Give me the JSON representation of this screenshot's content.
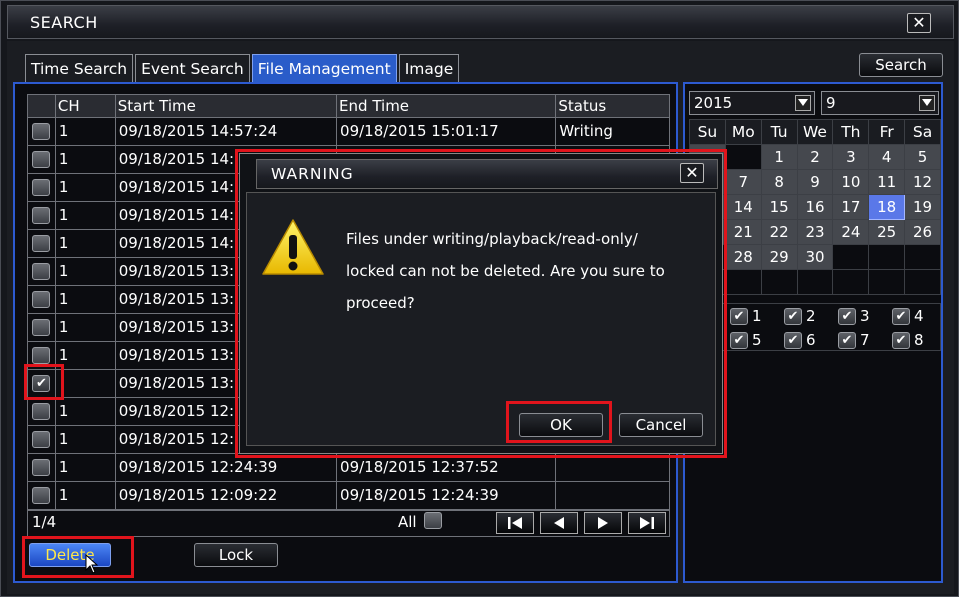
{
  "window": {
    "title": "SEARCH"
  },
  "tabs": [
    {
      "label": "Time Search",
      "active": false
    },
    {
      "label": "Event Search",
      "active": false
    },
    {
      "label": "File Management",
      "active": true
    },
    {
      "label": "Image",
      "active": false
    }
  ],
  "search_button": "Search",
  "table": {
    "headers": [
      "CH",
      "Start Time",
      "End Time",
      "Status"
    ],
    "rows": [
      {
        "ch": "1",
        "start": "09/18/2015 14:57:24",
        "end": "09/18/2015 15:01:17",
        "status": "Writing",
        "checked": false
      },
      {
        "ch": "1",
        "start": "09/18/2015 14:",
        "end": "",
        "status": "",
        "checked": false
      },
      {
        "ch": "1",
        "start": "09/18/2015 14:",
        "end": "",
        "status": "",
        "checked": false
      },
      {
        "ch": "1",
        "start": "09/18/2015 14:",
        "end": "",
        "status": "",
        "checked": false
      },
      {
        "ch": "1",
        "start": "09/18/2015 14:",
        "end": "",
        "status": "",
        "checked": false
      },
      {
        "ch": "1",
        "start": "09/18/2015 13:",
        "end": "",
        "status": "",
        "checked": false
      },
      {
        "ch": "1",
        "start": "09/18/2015 13:",
        "end": "",
        "status": "",
        "checked": false
      },
      {
        "ch": "1",
        "start": "09/18/2015 13:",
        "end": "",
        "status": "",
        "checked": false
      },
      {
        "ch": "1",
        "start": "09/18/2015 13:",
        "end": "",
        "status": "",
        "checked": false
      },
      {
        "ch": "",
        "start": "09/18/2015 13:",
        "end": "",
        "status": "",
        "checked": true
      },
      {
        "ch": "1",
        "start": "09/18/2015 12:",
        "end": "",
        "status": "",
        "checked": false
      },
      {
        "ch": "1",
        "start": "09/18/2015 12:",
        "end": "",
        "status": "",
        "checked": false
      },
      {
        "ch": "1",
        "start": "09/18/2015 12:24:39",
        "end": "09/18/2015 12:37:52",
        "status": "",
        "checked": false
      },
      {
        "ch": "1",
        "start": "09/18/2015 12:09:22",
        "end": "09/18/2015 12:24:39",
        "status": "",
        "checked": false
      }
    ]
  },
  "footer": {
    "page": "1/4",
    "all_label": "All"
  },
  "buttons": {
    "delete": "Delete",
    "lock": "Lock"
  },
  "calendar": {
    "year": "2015",
    "month": "9",
    "weekdays": [
      "Su",
      "Mo",
      "Tu",
      "We",
      "Th",
      "Fr",
      "Sa"
    ],
    "weeks": [
      [
        "",
        "",
        "1",
        "2",
        "3",
        "4",
        "5"
      ],
      [
        "",
        "7",
        "8",
        "9",
        "10",
        "11",
        "12"
      ],
      [
        "",
        "14",
        "15",
        "16",
        "17",
        "18",
        "19"
      ],
      [
        "",
        "21",
        "22",
        "23",
        "24",
        "25",
        "26"
      ],
      [
        "",
        "28",
        "29",
        "30",
        "",
        "",
        ""
      ],
      [
        "",
        "",
        "",
        "",
        "",
        "",
        ""
      ]
    ],
    "selected_day": "18"
  },
  "channels": [
    "1",
    "2",
    "3",
    "4",
    "5",
    "6",
    "7",
    "8"
  ],
  "dialog": {
    "title": "WARNING",
    "message_lines": [
      "Files under writing/playback/read-only/",
      "locked can not be deleted. Are you sure to",
      "proceed?"
    ],
    "ok": "OK",
    "cancel": "Cancel"
  },
  "colors": {
    "accent_blue": "#2a5cc9",
    "highlight_red": "#e1141c",
    "today": "#5a78e8"
  }
}
